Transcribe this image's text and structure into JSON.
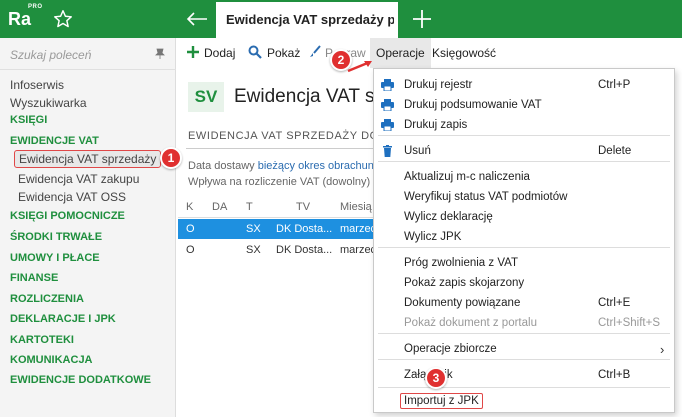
{
  "app": {
    "logo_text": "Ra",
    "logo_sup": "PRO"
  },
  "tabs": {
    "active_label": "Ewidencja VAT sprzedaży po"
  },
  "sidebar": {
    "search_placeholder": "Szukaj poleceń",
    "items": [
      {
        "label": "Infoserwis",
        "type": "plain"
      },
      {
        "label": "Wyszukiwarka",
        "type": "plain"
      },
      {
        "label": "KSIĘGI",
        "type": "head"
      },
      {
        "label": "EWIDENCJE VAT",
        "type": "head"
      },
      {
        "label": "Ewidencja VAT sprzedaży",
        "type": "selected"
      },
      {
        "label": "Ewidencja VAT zakupu",
        "type": "sub"
      },
      {
        "label": "Ewidencja VAT OSS",
        "type": "sub"
      },
      {
        "label": "KSIĘGI POMOCNICZE",
        "type": "head"
      },
      {
        "label": "ŚRODKI TRWAŁE",
        "type": "head"
      },
      {
        "label": "UMOWY I PŁACE",
        "type": "head"
      },
      {
        "label": "FINANSE",
        "type": "head"
      },
      {
        "label": "ROZLICZENIA",
        "type": "head"
      },
      {
        "label": "DEKLARACJE I JPK",
        "type": "head"
      },
      {
        "label": "KARTOTEKI",
        "type": "head"
      },
      {
        "label": "KOMUNIKACJA",
        "type": "head"
      },
      {
        "label": "EWIDENCJE DODATKOWE",
        "type": "head"
      }
    ]
  },
  "toolbar": {
    "add": "Dodaj",
    "show": "Pokaż",
    "edit": "Popraw",
    "operations": "Operacje",
    "accounting": "Księgowość"
  },
  "main": {
    "badge": "SV",
    "title": "Ewidencja VAT spr",
    "section": "EWIDENCJA VAT SPRZEDAŻY DO",
    "filter1_label": "Data dostawy",
    "filter1_value": "bieżący okres obrachunk",
    "filter2": "Wpływa na rozliczenie VAT (dowolny)",
    "columns": [
      "K",
      "DA",
      "T",
      "TV",
      "Miesią"
    ],
    "rows": [
      [
        "O",
        "",
        "SX",
        "DK Dosta...",
        "marzec"
      ],
      [
        "O",
        "",
        "SX",
        "DK Dosta...",
        "marzec"
      ]
    ]
  },
  "menu": {
    "items": [
      {
        "label": "Drukuj rejestr",
        "shortcut": "Ctrl+P",
        "icon": "printer-icon"
      },
      {
        "label": "Drukuj podsumowanie VAT",
        "shortcut": "",
        "icon": "printer-icon"
      },
      {
        "label": "Drukuj zapis",
        "shortcut": "",
        "icon": "printer-icon"
      },
      {
        "label": "Usuń",
        "shortcut": "Delete",
        "icon": "trash-icon"
      },
      {
        "label": "Aktualizuj m-c naliczenia",
        "shortcut": ""
      },
      {
        "label": "Weryfikuj status VAT podmiotów",
        "shortcut": ""
      },
      {
        "label": "Wylicz deklarację",
        "shortcut": ""
      },
      {
        "label": "Wylicz JPK",
        "shortcut": ""
      },
      {
        "label": "Próg zwolnienia z VAT",
        "shortcut": ""
      },
      {
        "label": "Pokaż zapis skojarzony",
        "shortcut": ""
      },
      {
        "label": "Dokumenty powiązane",
        "shortcut": "Ctrl+E"
      },
      {
        "label": "Pokaż dokument z portalu",
        "shortcut": "Ctrl+Shift+S",
        "disabled": true
      },
      {
        "label": "Operacje zbiorcze",
        "shortcut": "",
        "submenu": true
      },
      {
        "label": "Załącznik",
        "shortcut": "Ctrl+B"
      },
      {
        "label": "Importuj z JPK",
        "shortcut": ""
      }
    ]
  },
  "callouts": [
    "1",
    "2",
    "3"
  ],
  "colors": {
    "brand": "#1f8f3e",
    "highlight": "#e04848",
    "selection": "#1e90e0"
  }
}
